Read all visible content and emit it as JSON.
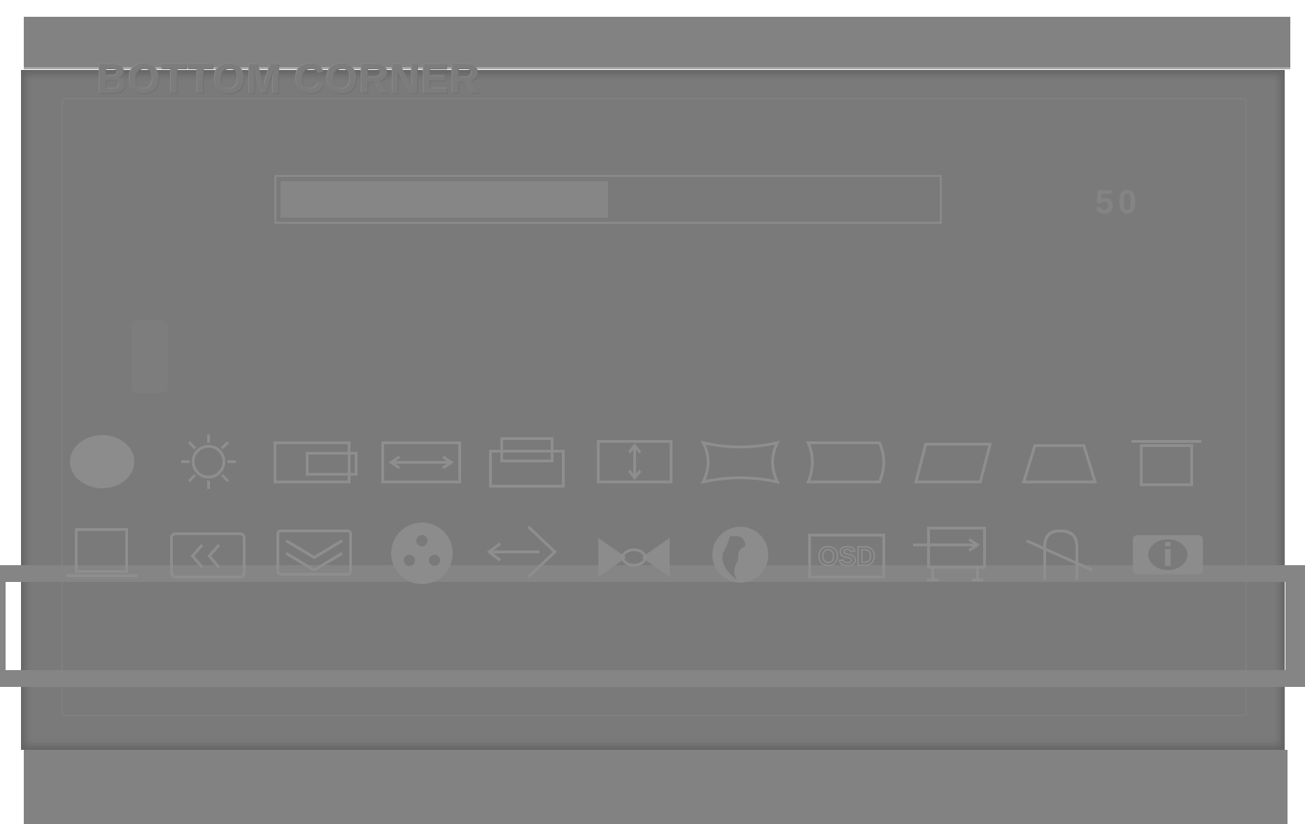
{
  "osd": {
    "title": "BOTTOM CORNER",
    "slider": {
      "value": "50",
      "fill_fraction": 0.5
    }
  },
  "colors": {
    "panel": "#7a7a7a",
    "band": "#828282",
    "icon_stroke": "#8e8e8e",
    "selection_band": "#858585"
  },
  "icons": {
    "row1": [
      "contrast-icon",
      "brightness-icon",
      "horizontal-position-icon",
      "horizontal-size-icon",
      "vertical-position-icon",
      "vertical-size-icon",
      "pincushion-icon",
      "pin-balance-icon",
      "parallelogram-icon",
      "trapezoid-icon",
      "top-corner-icon"
    ],
    "row2": [
      "bottom-corner-icon",
      "horizontal-moire-icon",
      "vertical-moire-icon",
      "color-icon",
      "recall-icon",
      "degauss-icon",
      "language-icon",
      "osd-position-icon",
      "geometry-icon",
      "rotation-icon",
      "information-icon"
    ]
  }
}
